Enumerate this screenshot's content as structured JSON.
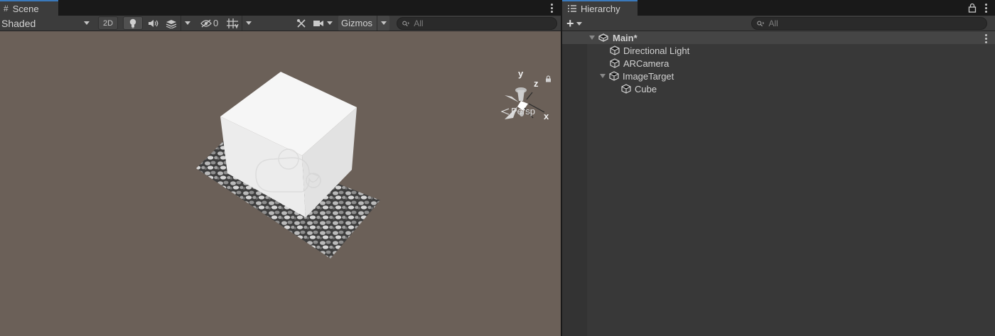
{
  "scene": {
    "tab_label": "Scene",
    "tab_icon": "grid-hash-icon",
    "shading_mode": "Shaded",
    "toggle_2d": "2D",
    "hidden_count": "0",
    "gizmos_label": "Gizmos",
    "search_placeholder": "All",
    "orientation": {
      "y_label": "y",
      "z_label": "z",
      "x_label": "x"
    },
    "projection_label": "Persp",
    "viewport_bg": "#6b6058"
  },
  "hierarchy": {
    "tab_label": "Hierarchy",
    "tab_icon": "list-icon",
    "add_label": "+",
    "search_placeholder": "All",
    "scene_name": "Main*",
    "items": [
      {
        "label": "Directional Light",
        "depth": 1,
        "expanded": null
      },
      {
        "label": "ARCamera",
        "depth": 1,
        "expanded": null
      },
      {
        "label": "ImageTarget",
        "depth": 1,
        "expanded": true
      },
      {
        "label": "Cube",
        "depth": 2,
        "expanded": null
      }
    ]
  },
  "colors": {
    "accent": "#3a79bb",
    "panel": "#383838",
    "toolbar": "#3c3c3c"
  }
}
